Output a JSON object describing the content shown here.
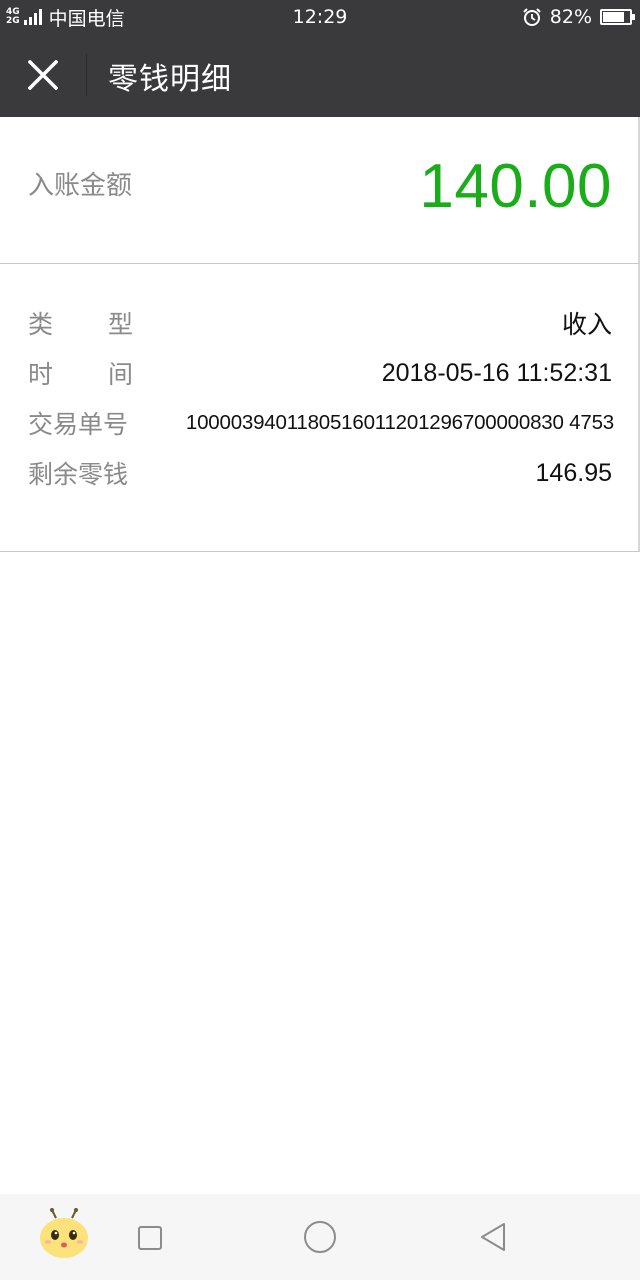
{
  "status_bar": {
    "network_top": "4G",
    "network_bottom": "2G",
    "carrier": "中国电信",
    "time": "12:29",
    "battery_percent": "82%",
    "battery_level": 0.82
  },
  "nav": {
    "title": "零钱明细",
    "close_icon": "close-icon"
  },
  "amount": {
    "label": "入账金额",
    "value": "140.00",
    "color": "#1aad19"
  },
  "details": {
    "type_label_1": "类",
    "type_label_2": "型",
    "type_value": "收入",
    "time_label_1": "时",
    "time_label_2": "间",
    "time_value": "2018-05-16 11:52:31",
    "txn_label": "交易单号",
    "txn_value": "1000039401180516011201296700000830 4753",
    "balance_label": "剩余零钱",
    "balance_value": "146.95"
  },
  "system_nav": {
    "recents_icon": "square-icon",
    "home_icon": "circle-icon",
    "back_icon": "triangle-back-icon"
  }
}
